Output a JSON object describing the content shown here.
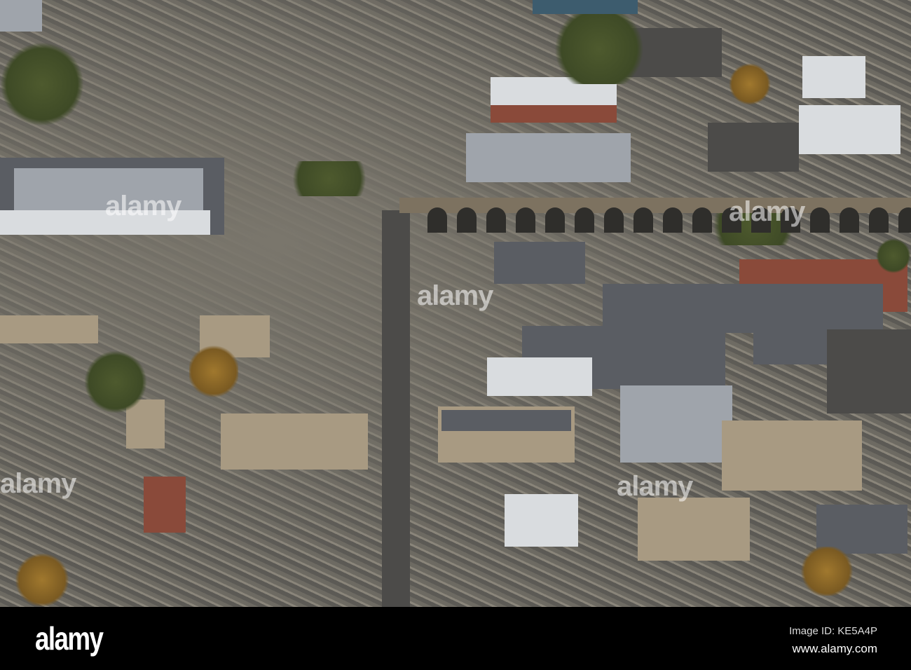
{
  "photo": {
    "subject": "Aerial view of town centre with railway viaduct",
    "watermark_text": "alamy"
  },
  "footer": {
    "logo": "alamy",
    "image_id": "Image ID: KE5A4P",
    "website": "www.alamy.com"
  }
}
